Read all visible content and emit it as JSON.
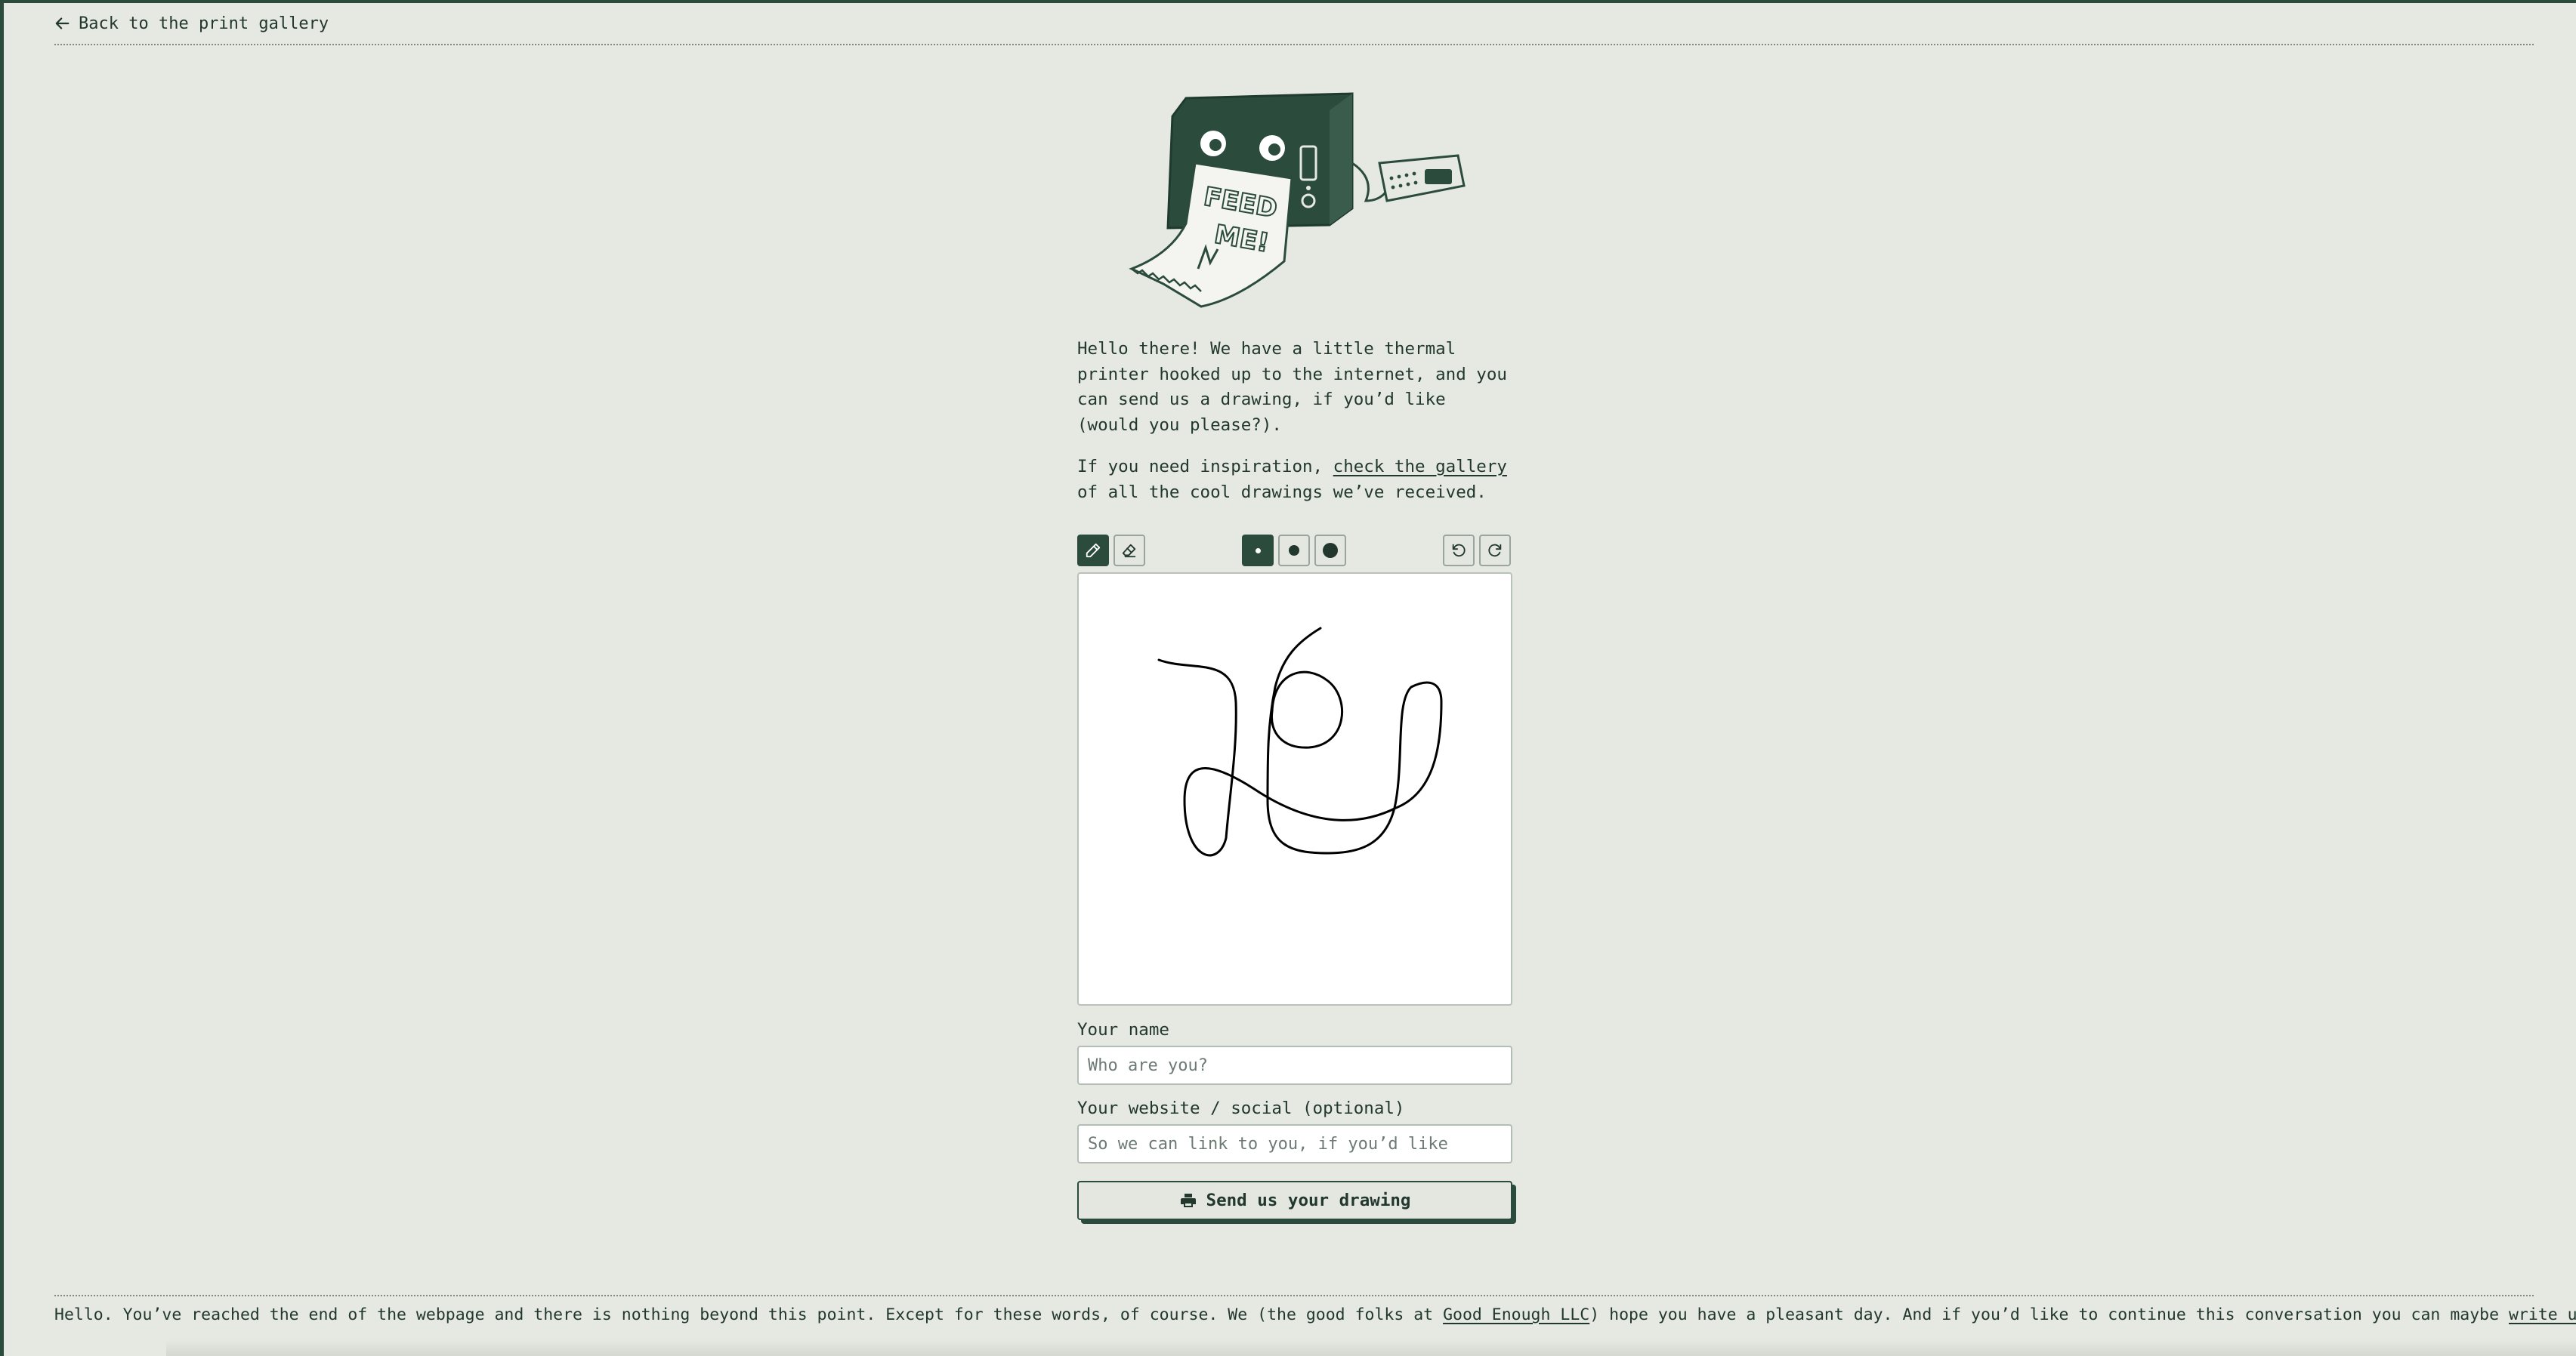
{
  "nav": {
    "back_label": "Back to the print gallery",
    "back_icon": "arrow-left-icon"
  },
  "hero": {
    "sign_text": [
      "FEED",
      "ME!"
    ]
  },
  "intro": {
    "p1": "Hello there! We have a little thermal printer hooked up to the internet, and you can send us a drawing, if you’d like (would you please?).",
    "p2_before": "If you need inspiration, ",
    "p2_link": "check the gallery",
    "p2_after": " of all the cool drawings we’ve received."
  },
  "toolbar": {
    "tools": [
      {
        "name": "pencil",
        "icon": "pencil-icon",
        "active": true
      },
      {
        "name": "eraser",
        "icon": "eraser-icon",
        "active": false
      }
    ],
    "brush_sizes": [
      {
        "size": "small",
        "active": true
      },
      {
        "size": "medium",
        "active": false
      },
      {
        "size": "large",
        "active": false
      }
    ],
    "history": [
      {
        "name": "undo",
        "icon": "undo-icon"
      },
      {
        "name": "redo",
        "icon": "redo-icon"
      }
    ]
  },
  "form": {
    "name_label": "Your name",
    "name_placeholder": "Who are you?",
    "name_value": "",
    "website_label": "Your website / social (optional)",
    "website_placeholder": "So we can link to you, if you’d like",
    "website_value": "",
    "submit_label": "Send us your drawing",
    "submit_icon": "printer-icon"
  },
  "footer": {
    "text_before": "Hello. You’ve reached the end of the webpage and there is nothing beyond this point. Except for these words, of course. We (the good folks at ",
    "link_company": "Good Enough LLC",
    "text_middle": ") hope you have a pleasant day. And if you’d like to continue this conversation you can maybe ",
    "link_email": "write us an email",
    "text_after": "."
  },
  "colors": {
    "accent": "#2b4b3d",
    "background": "#e6e9e2",
    "text": "#22382e"
  }
}
